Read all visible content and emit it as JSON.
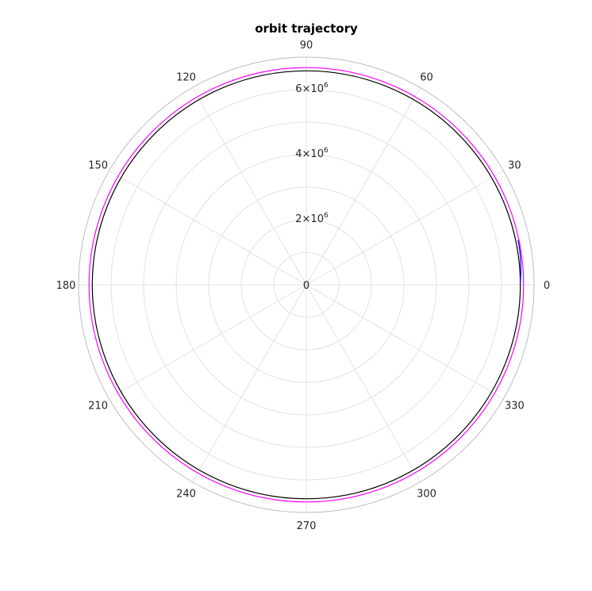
{
  "chart_data": {
    "type": "polar-line",
    "title": "orbit trajectory",
    "r_lim": [
      0,
      7000000
    ],
    "r_ticks": [
      {
        "value": 0,
        "label": "0"
      },
      {
        "value": 2000000,
        "base": "2×10",
        "exp": "6"
      },
      {
        "value": 4000000,
        "base": "4×10",
        "exp": "6"
      },
      {
        "value": 6000000,
        "base": "6×10",
        "exp": "6"
      }
    ],
    "theta_ticks": [
      "0",
      "30",
      "60",
      "90",
      "120",
      "150",
      "180",
      "210",
      "240",
      "270",
      "300",
      "330"
    ],
    "theta_tick_values": [
      0,
      30,
      60,
      90,
      120,
      150,
      180,
      210,
      240,
      270,
      300,
      330
    ],
    "grid": true,
    "series": [
      {
        "type": "circle",
        "radius": 6578000,
        "color": "#000000"
      },
      {
        "type": "circle",
        "radius": 6678000,
        "color": "#ff00ff"
      },
      {
        "type": "arc",
        "radius_start": 6570000,
        "radius_end": 6650000,
        "theta_start": 0,
        "theta_end": 12,
        "color": "#0000ff"
      }
    ]
  }
}
